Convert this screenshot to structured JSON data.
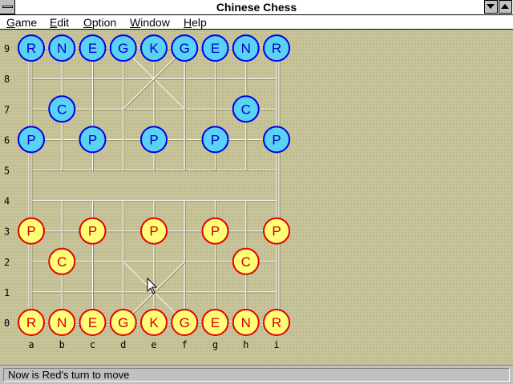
{
  "window": {
    "title": "Chinese Chess"
  },
  "menu": [
    "Game",
    "Edit",
    "Option",
    "Window",
    "Help"
  ],
  "board": {
    "rank_labels": [
      "0",
      "1",
      "2",
      "3",
      "4",
      "5",
      "6",
      "7",
      "8",
      "9"
    ],
    "file_labels": [
      "a",
      "b",
      "c",
      "d",
      "e",
      "f",
      "g",
      "h",
      "i"
    ],
    "pieces": [
      {
        "side": "blue",
        "label": "R",
        "file": 0,
        "rank": 9
      },
      {
        "side": "blue",
        "label": "N",
        "file": 1,
        "rank": 9
      },
      {
        "side": "blue",
        "label": "E",
        "file": 2,
        "rank": 9
      },
      {
        "side": "blue",
        "label": "G",
        "file": 3,
        "rank": 9
      },
      {
        "side": "blue",
        "label": "K",
        "file": 4,
        "rank": 9
      },
      {
        "side": "blue",
        "label": "G",
        "file": 5,
        "rank": 9
      },
      {
        "side": "blue",
        "label": "E",
        "file": 6,
        "rank": 9
      },
      {
        "side": "blue",
        "label": "N",
        "file": 7,
        "rank": 9
      },
      {
        "side": "blue",
        "label": "R",
        "file": 8,
        "rank": 9
      },
      {
        "side": "blue",
        "label": "C",
        "file": 1,
        "rank": 7
      },
      {
        "side": "blue",
        "label": "C",
        "file": 7,
        "rank": 7
      },
      {
        "side": "blue",
        "label": "P",
        "file": 0,
        "rank": 6
      },
      {
        "side": "blue",
        "label": "P",
        "file": 2,
        "rank": 6
      },
      {
        "side": "blue",
        "label": "P",
        "file": 4,
        "rank": 6
      },
      {
        "side": "blue",
        "label": "P",
        "file": 6,
        "rank": 6
      },
      {
        "side": "blue",
        "label": "P",
        "file": 8,
        "rank": 6
      },
      {
        "side": "red",
        "label": "P",
        "file": 0,
        "rank": 3
      },
      {
        "side": "red",
        "label": "P",
        "file": 2,
        "rank": 3
      },
      {
        "side": "red",
        "label": "P",
        "file": 4,
        "rank": 3
      },
      {
        "side": "red",
        "label": "P",
        "file": 6,
        "rank": 3
      },
      {
        "side": "red",
        "label": "P",
        "file": 8,
        "rank": 3
      },
      {
        "side": "red",
        "label": "C",
        "file": 1,
        "rank": 2
      },
      {
        "side": "red",
        "label": "C",
        "file": 7,
        "rank": 2
      },
      {
        "side": "red",
        "label": "R",
        "file": 0,
        "rank": 0
      },
      {
        "side": "red",
        "label": "N",
        "file": 1,
        "rank": 0
      },
      {
        "side": "red",
        "label": "E",
        "file": 2,
        "rank": 0
      },
      {
        "side": "red",
        "label": "G",
        "file": 3,
        "rank": 0
      },
      {
        "side": "red",
        "label": "K",
        "file": 4,
        "rank": 0
      },
      {
        "side": "red",
        "label": "G",
        "file": 5,
        "rank": 0
      },
      {
        "side": "red",
        "label": "E",
        "file": 6,
        "rank": 0
      },
      {
        "side": "red",
        "label": "N",
        "file": 7,
        "rank": 0
      },
      {
        "side": "red",
        "label": "R",
        "file": 8,
        "rank": 0
      }
    ]
  },
  "colors": {
    "blue_fill": "#5ad2f5",
    "blue_stroke": "#0000e6",
    "blue_text": "#0000c8",
    "red_fill": "#ffff78",
    "red_stroke": "#e60000",
    "red_text": "#d20000",
    "board_line": "#ffffff",
    "board_line_shadow": "#8c8864"
  },
  "status": {
    "text": "Now is Red's turn to move"
  }
}
